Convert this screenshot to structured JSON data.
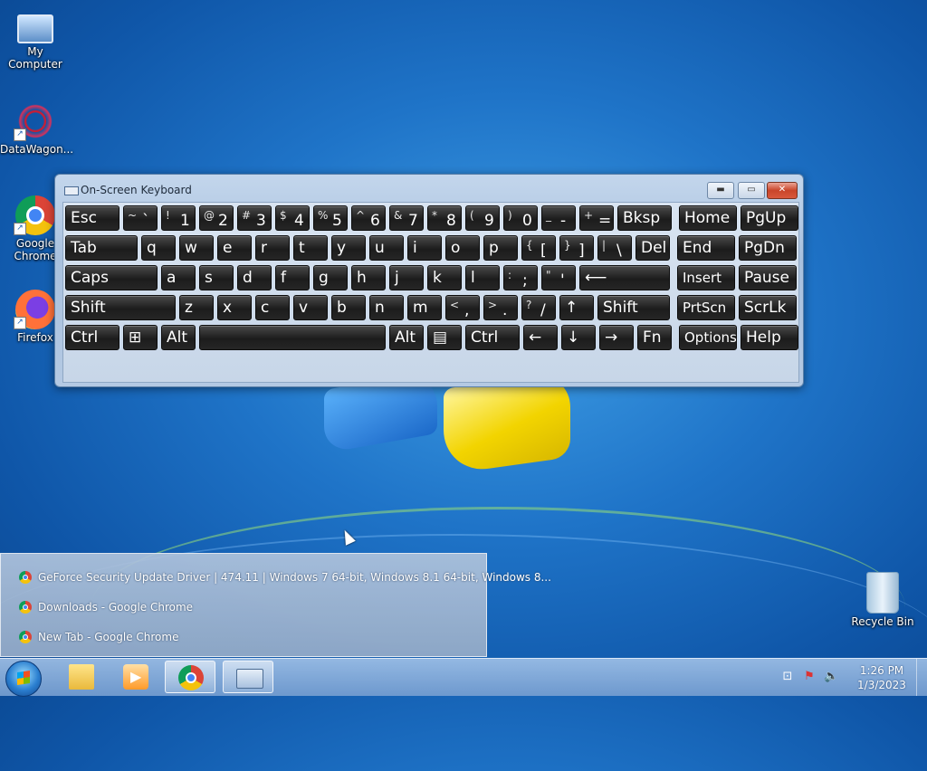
{
  "desktop": {
    "icons": [
      {
        "label": "My Computer"
      },
      {
        "label": "DataWagon..."
      },
      {
        "label": "Google Chrome"
      },
      {
        "label": "Firefox"
      },
      {
        "label": "Recycle Bin"
      }
    ]
  },
  "osk": {
    "title": "On-Screen Keyboard",
    "window_buttons": {
      "minimize": "▬",
      "maximize": "▭",
      "close": "✕"
    },
    "rows": [
      [
        {
          "main": "Esc"
        },
        {
          "shift": "~",
          "main": "`"
        },
        {
          "shift": "!",
          "main": "1"
        },
        {
          "shift": "@",
          "main": "2"
        },
        {
          "shift": "#",
          "main": "3"
        },
        {
          "shift": "$",
          "main": "4"
        },
        {
          "shift": "%",
          "main": "5"
        },
        {
          "shift": "^",
          "main": "6"
        },
        {
          "shift": "&",
          "main": "7"
        },
        {
          "shift": "*",
          "main": "8"
        },
        {
          "shift": "(",
          "main": "9"
        },
        {
          "shift": ")",
          "main": "0"
        },
        {
          "shift": "_",
          "main": "-"
        },
        {
          "shift": "+",
          "main": "="
        },
        {
          "main": "Bksp"
        },
        {
          "main": "Home"
        },
        {
          "main": "PgUp"
        }
      ],
      [
        {
          "main": "Tab"
        },
        {
          "main": "q"
        },
        {
          "main": "w"
        },
        {
          "main": "e"
        },
        {
          "main": "r"
        },
        {
          "main": "t"
        },
        {
          "main": "y"
        },
        {
          "main": "u"
        },
        {
          "main": "i"
        },
        {
          "main": "o"
        },
        {
          "main": "p"
        },
        {
          "shift": "{",
          "main": "["
        },
        {
          "shift": "}",
          "main": "]"
        },
        {
          "shift": "|",
          "main": "\\"
        },
        {
          "main": "Del"
        },
        {
          "main": "End"
        },
        {
          "main": "PgDn"
        }
      ],
      [
        {
          "main": "Caps"
        },
        {
          "main": "a"
        },
        {
          "main": "s"
        },
        {
          "main": "d"
        },
        {
          "main": "f"
        },
        {
          "main": "g"
        },
        {
          "main": "h"
        },
        {
          "main": "j"
        },
        {
          "main": "k"
        },
        {
          "main": "l"
        },
        {
          "shift": ":",
          "main": ";"
        },
        {
          "shift": "\"",
          "main": "'"
        },
        {
          "main": "⟵"
        },
        {
          "main": "Insert"
        },
        {
          "main": "Pause"
        }
      ],
      [
        {
          "main": "Shift"
        },
        {
          "main": "z"
        },
        {
          "main": "x"
        },
        {
          "main": "c"
        },
        {
          "main": "v"
        },
        {
          "main": "b"
        },
        {
          "main": "n"
        },
        {
          "main": "m"
        },
        {
          "shift": "<",
          "main": ","
        },
        {
          "shift": ">",
          "main": "."
        },
        {
          "shift": "?",
          "main": "/"
        },
        {
          "main": "↑"
        },
        {
          "main": "Shift"
        },
        {
          "main": "PrtScn"
        },
        {
          "main": "ScrLk"
        }
      ],
      [
        {
          "main": "Ctrl"
        },
        {
          "main": "⊞"
        },
        {
          "main": "Alt"
        },
        {
          "main": ""
        },
        {
          "main": "Alt"
        },
        {
          "main": "▤"
        },
        {
          "main": "Ctrl"
        },
        {
          "main": "←"
        },
        {
          "main": "↓"
        },
        {
          "main": "→"
        },
        {
          "main": "Fn"
        },
        {
          "main": "Options"
        },
        {
          "main": "Help"
        }
      ]
    ]
  },
  "popup": {
    "items": [
      {
        "label": "GeForce Security Update Driver | 474.11 | Windows 7 64-bit, Windows 8.1 64-bit, Windows 8..."
      },
      {
        "label": "Downloads - Google Chrome"
      },
      {
        "label": "New Tab - Google Chrome"
      }
    ]
  },
  "taskbar": {
    "clock_time": "1:26 PM",
    "clock_date": "1/3/2023"
  }
}
